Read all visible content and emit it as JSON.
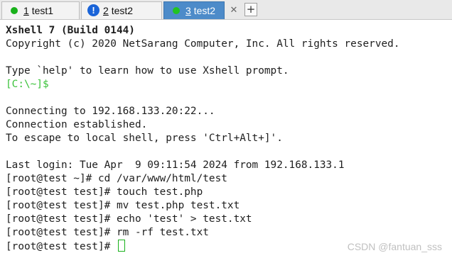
{
  "tabs": [
    {
      "number": "1",
      "name": "test1",
      "status": "connected",
      "active": false
    },
    {
      "number": "2",
      "name": "test2",
      "status": "warning",
      "active": false
    },
    {
      "number": "3",
      "name": "test2",
      "status": "connected",
      "active": true
    }
  ],
  "tab_close_glyph": "✕",
  "tab_add_glyph": "+",
  "warning_glyph": "!",
  "colors": {
    "active_tab": "#4d8bc9",
    "status_green": "#19b11b",
    "warning_blue": "#1a64d8",
    "prompt_green": "#3ac23a"
  },
  "terminal": {
    "lines": [
      {
        "text": "Xshell 7 (Build 0144)",
        "style": "bold"
      },
      {
        "text": "Copyright (c) 2020 NetSarang Computer, Inc. All rights reserved.",
        "style": ""
      },
      {
        "text": "",
        "style": ""
      },
      {
        "text": "Type `help' to learn how to use Xshell prompt.",
        "style": ""
      },
      {
        "text": "[C:\\~]$",
        "style": "green"
      },
      {
        "text": "",
        "style": ""
      },
      {
        "text": "Connecting to 192.168.133.20:22...",
        "style": ""
      },
      {
        "text": "Connection established.",
        "style": ""
      },
      {
        "text": "To escape to local shell, press 'Ctrl+Alt+]'.",
        "style": ""
      },
      {
        "text": "",
        "style": ""
      },
      {
        "text": "Last login: Tue Apr  9 09:11:54 2024 from 192.168.133.1",
        "style": ""
      },
      {
        "text": "[root@test ~]# cd /var/www/html/test",
        "style": ""
      },
      {
        "text": "[root@test test]# touch test.php",
        "style": ""
      },
      {
        "text": "[root@test test]# mv test.php test.txt",
        "style": ""
      },
      {
        "text": "[root@test test]# echo 'test' > test.txt",
        "style": ""
      },
      {
        "text": "[root@test test]# rm -rf test.txt",
        "style": ""
      }
    ],
    "current_prompt": "[root@test test]# "
  },
  "watermark": "CSDN @fantuan_sss"
}
